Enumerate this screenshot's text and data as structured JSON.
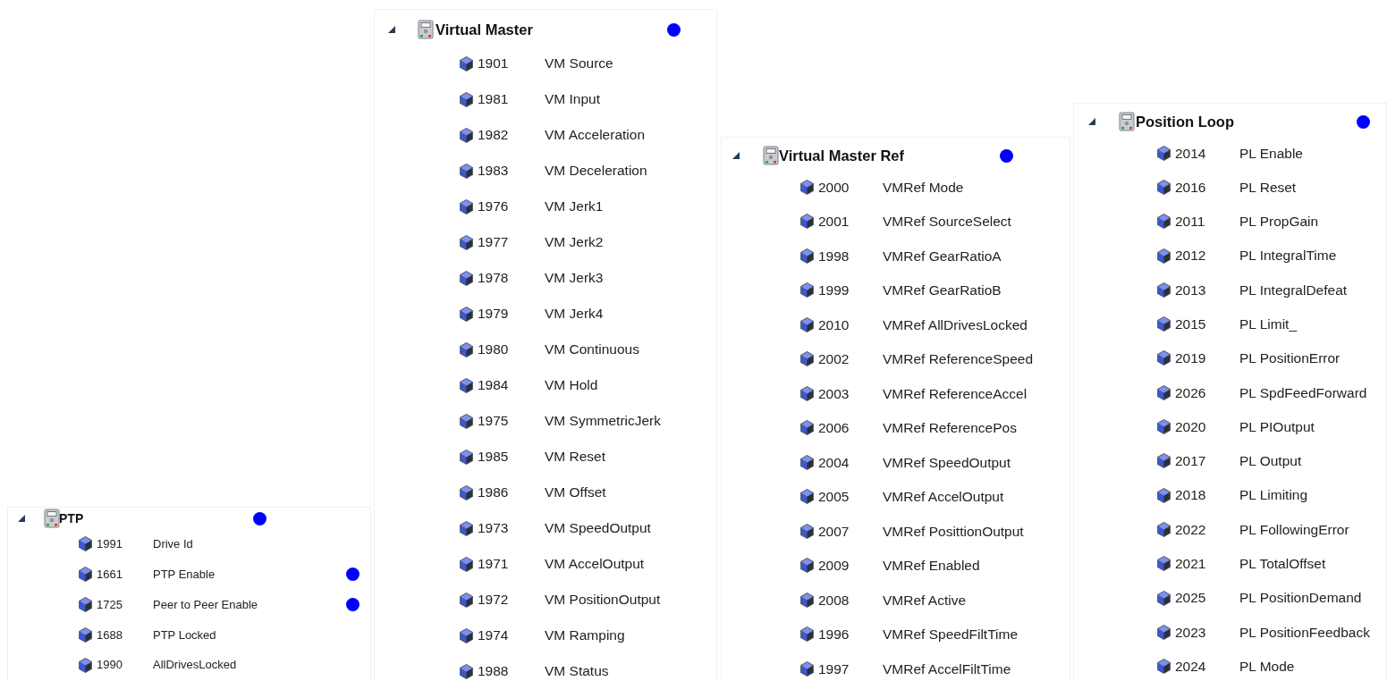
{
  "panels": [
    {
      "title": "PTP",
      "expanded": true,
      "marked": true,
      "params": [
        {
          "id": "1991",
          "name": "Drive Id",
          "marked": false
        },
        {
          "id": "1661",
          "name": "PTP Enable",
          "marked": true
        },
        {
          "id": "1725",
          "name": "Peer to Peer Enable",
          "marked": true
        },
        {
          "id": "1688",
          "name": "PTP Locked",
          "marked": false
        },
        {
          "id": "1990",
          "name": "AllDrivesLocked",
          "marked": false
        }
      ]
    },
    {
      "title": "Virtual Master",
      "expanded": true,
      "marked": true,
      "params": [
        {
          "id": "1901",
          "name": "VM Source",
          "marked": false
        },
        {
          "id": "1981",
          "name": "VM Input",
          "marked": false
        },
        {
          "id": "1982",
          "name": "VM Acceleration",
          "marked": false
        },
        {
          "id": "1983",
          "name": "VM Deceleration",
          "marked": false
        },
        {
          "id": "1976",
          "name": "VM Jerk1",
          "marked": false
        },
        {
          "id": "1977",
          "name": "VM Jerk2",
          "marked": false
        },
        {
          "id": "1978",
          "name": "VM Jerk3",
          "marked": false
        },
        {
          "id": "1979",
          "name": "VM Jerk4",
          "marked": false
        },
        {
          "id": "1980",
          "name": "VM Continuous",
          "marked": false
        },
        {
          "id": "1984",
          "name": "VM Hold",
          "marked": false
        },
        {
          "id": "1975",
          "name": "VM SymmetricJerk",
          "marked": false
        },
        {
          "id": "1985",
          "name": "VM Reset",
          "marked": false
        },
        {
          "id": "1986",
          "name": "VM Offset",
          "marked": false
        },
        {
          "id": "1973",
          "name": "VM SpeedOutput",
          "marked": false
        },
        {
          "id": "1971",
          "name": "VM AccelOutput",
          "marked": false
        },
        {
          "id": "1972",
          "name": "VM PositionOutput",
          "marked": false
        },
        {
          "id": "1974",
          "name": "VM Ramping",
          "marked": false
        },
        {
          "id": "1988",
          "name": "VM Status",
          "marked": false
        }
      ]
    },
    {
      "title": "Virtual Master Ref",
      "expanded": true,
      "marked": true,
      "params": [
        {
          "id": "2000",
          "name": "VMRef Mode",
          "marked": false
        },
        {
          "id": "2001",
          "name": "VMRef SourceSelect",
          "marked": false
        },
        {
          "id": "1998",
          "name": "VMRef GearRatioA",
          "marked": false
        },
        {
          "id": "1999",
          "name": "VMRef GearRatioB",
          "marked": false
        },
        {
          "id": "2010",
          "name": "VMRef AllDrivesLocked",
          "marked": false
        },
        {
          "id": "2002",
          "name": "VMRef ReferenceSpeed",
          "marked": false
        },
        {
          "id": "2003",
          "name": "VMRef ReferenceAccel",
          "marked": false
        },
        {
          "id": "2006",
          "name": "VMRef ReferencePos",
          "marked": false
        },
        {
          "id": "2004",
          "name": "VMRef SpeedOutput",
          "marked": false
        },
        {
          "id": "2005",
          "name": "VMRef AccelOutput",
          "marked": false
        },
        {
          "id": "2007",
          "name": "VMRef PosittionOutput",
          "marked": false
        },
        {
          "id": "2009",
          "name": "VMRef Enabled",
          "marked": false
        },
        {
          "id": "2008",
          "name": "VMRef Active",
          "marked": false
        },
        {
          "id": "1996",
          "name": "VMRef SpeedFiltTime",
          "marked": false
        },
        {
          "id": "1997",
          "name": "VMRef AccelFiltTime",
          "marked": false
        }
      ]
    },
    {
      "title": "Position Loop",
      "expanded": true,
      "marked": true,
      "params": [
        {
          "id": "2014",
          "name": "PL Enable",
          "marked": false
        },
        {
          "id": "2016",
          "name": "PL Reset",
          "marked": false
        },
        {
          "id": "2011",
          "name": "PL PropGain",
          "marked": false
        },
        {
          "id": "2012",
          "name": "PL IntegralTime",
          "marked": false
        },
        {
          "id": "2013",
          "name": "PL IntegralDefeat",
          "marked": false
        },
        {
          "id": "2015",
          "name": "PL Limit_",
          "marked": false
        },
        {
          "id": "2019",
          "name": "PL PositionError",
          "marked": false
        },
        {
          "id": "2026",
          "name": "PL SpdFeedForward",
          "marked": false
        },
        {
          "id": "2020",
          "name": "PL PIOutput",
          "marked": false
        },
        {
          "id": "2017",
          "name": "PL Output",
          "marked": false
        },
        {
          "id": "2018",
          "name": "PL Limiting",
          "marked": false
        },
        {
          "id": "2022",
          "name": "PL FollowingError",
          "marked": false
        },
        {
          "id": "2021",
          "name": "PL TotalOffset",
          "marked": false
        },
        {
          "id": "2025",
          "name": "PL PositionDemand",
          "marked": false
        },
        {
          "id": "2023",
          "name": "PL PositionFeedback",
          "marked": false
        },
        {
          "id": "2024",
          "name": "PL Mode",
          "marked": false
        }
      ]
    }
  ]
}
